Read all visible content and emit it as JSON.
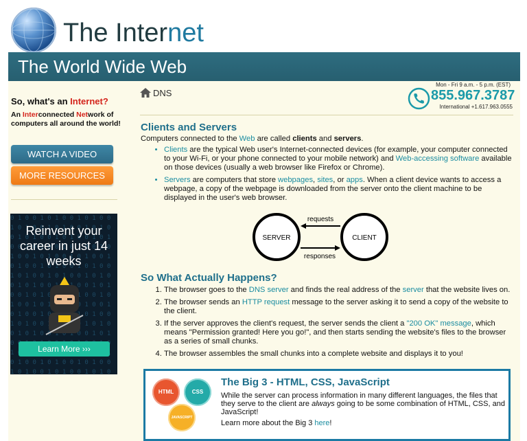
{
  "header": {
    "title_part1": "The Inter",
    "title_part2": "net",
    "banner": "The World Wide Web",
    "logo_icon": "globe-icon"
  },
  "sidebar": {
    "question_prefix": "So, what's an ",
    "question_word": "Internet?",
    "desc": [
      "An ",
      "Inter",
      "connected ",
      "Net",
      "work of computers all around the world!"
    ],
    "watch_video": "WATCH A VIDEO",
    "more_resources": "MORE RESOURCES",
    "ad": {
      "title": "Reinvent your career in just 14 weeks",
      "button": "Learn More",
      "button_icon": "arrow-right-icon"
    }
  },
  "breadcrumb": {
    "icon": "home-icon",
    "label": "DNS"
  },
  "contact": {
    "hours": "Mon - Fri 9 a.m. - 5 p.m. (EST)",
    "phone": "855.967.3787",
    "international": "International +1.617.963.0555",
    "icon": "phone-icon"
  },
  "section1": {
    "heading": "Clients and Servers",
    "intro": [
      "Computers connected to the ",
      "Web",
      " are called ",
      "clients",
      " and ",
      "servers",
      "."
    ],
    "bullet1": [
      "Clients",
      " are the typical Web user's Internet-connected devices (for example, your computer connected to your Wi-Fi, or your phone connected to your mobile network) and ",
      "Web-accessing software",
      " available on those devices (usually a web browser like Firefox or Chrome)."
    ],
    "bullet2": [
      "Servers",
      " are computers that store ",
      "webpages",
      ", ",
      "sites",
      ", or ",
      "apps",
      ". When a client device wants to access a webpage, a copy of the webpage is downloaded from the server onto the client machine to be displayed in the user's web browser."
    ]
  },
  "diagram": {
    "server": "SERVER",
    "client": "CLIENT",
    "requests": "requests",
    "responses": "responses"
  },
  "section2": {
    "heading": "So What Actually Happens?",
    "step1": [
      "The browser goes to the ",
      "DNS server",
      " and finds the real address of the ",
      "server",
      " that the website lives on."
    ],
    "step2": [
      "The browser sends an ",
      "HTTP request",
      " message to the server asking it to send a copy of the website to the client."
    ],
    "step3": [
      "If the server approves the client's request, the server sends the client a ",
      "\"200 OK\" message",
      ", which means \"Permission granted! Here you go!\", and then starts sending the website's files to the browser as a series of small chunks."
    ],
    "step4": "The browser assembles the small chunks into a complete website and displays it to you!"
  },
  "big3": {
    "badge_html": "HTML",
    "badge_css": "CSS",
    "badge_js": "JAVASCRIPT",
    "title": "The Big 3 - HTML, CSS, JavaScript",
    "text": [
      "While the server can process information in many different languages, the files that they serve to the client are ",
      "always",
      " going to be some combination of HTML, CSS, and JavaScript!"
    ],
    "more": [
      "Learn more about the Big 3 ",
      "here",
      "!"
    ]
  },
  "colors": {
    "teal": "#1a8ca0",
    "banner": "#2e6d80",
    "cream": "#fcfae9",
    "red": "#d4241c",
    "orange": "#f58a22"
  }
}
